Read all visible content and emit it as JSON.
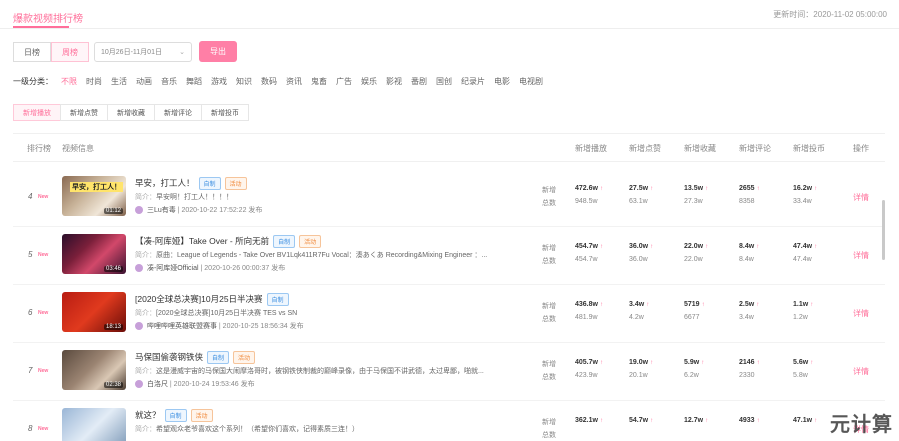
{
  "top_tab": "爆款视频排行榜",
  "update_time": "更新时间：2020-11-02 05:00:00",
  "period": {
    "day": "日榜",
    "week": "周榜"
  },
  "date_range": "10月26日-11月01日",
  "export_label": "导出",
  "category": {
    "label": "一级分类：",
    "items": [
      "不限",
      "时尚",
      "生活",
      "动画",
      "音乐",
      "舞蹈",
      "游戏",
      "知识",
      "数码",
      "资讯",
      "鬼畜",
      "广告",
      "娱乐",
      "影视",
      "番剧",
      "国创",
      "纪录片",
      "电影",
      "电视剧"
    ]
  },
  "metric_tabs": [
    "新增播放",
    "新增点赞",
    "新增收藏",
    "新增评论",
    "新增投币"
  ],
  "table_headers": {
    "rank": "排行榜",
    "info": "视频信息",
    "play": "新增播放",
    "like": "新增点赞",
    "fav": "新增收藏",
    "comment": "新增评论",
    "coin": "新增投币",
    "op": "操作"
  },
  "labels": {
    "inc": "新增",
    "tot": "总数",
    "detail": "详情",
    "desc_prefix": "简介：",
    "published": "发布",
    "new": "New"
  },
  "rows": [
    {
      "rank": "4",
      "title": "早安，打工人！",
      "badges": [
        "自制",
        "活动"
      ],
      "desc": "早安啊！打工人！！！！",
      "up": "三Lu有毒",
      "date": "2020-10-22 17:52:22",
      "duration": "01:12",
      "thumb_caption": "早安，打工人！",
      "play": [
        "472.6w",
        "948.5w"
      ],
      "like": [
        "27.5w",
        "63.1w"
      ],
      "fav": [
        "13.5w",
        "27.3w"
      ],
      "comment": [
        "2655",
        "8358"
      ],
      "coin": [
        "16.2w",
        "33.4w"
      ]
    },
    {
      "rank": "5",
      "title": "【凑-阿库娅】Take Over - 所向无前",
      "badges": [
        "自制",
        "活动"
      ],
      "desc": "原曲：League of Legends - Take Over BV1Lqk411R7Fu Vocal：湊あくあ Recording&Mixing Engineer ：...",
      "up": "凑-阿库娅Official",
      "date": "2020-10-26 00:00:37",
      "duration": "03:46",
      "thumb_caption": "",
      "play": [
        "454.7w",
        "454.7w"
      ],
      "like": [
        "36.0w",
        "36.0w"
      ],
      "fav": [
        "22.0w",
        "22.0w"
      ],
      "comment": [
        "8.4w",
        "8.4w"
      ],
      "coin": [
        "47.4w",
        "47.4w"
      ]
    },
    {
      "rank": "6",
      "title": "[2020全球总决赛]10月25日半决赛",
      "badges": [
        "自制"
      ],
      "desc": "[2020全球总决赛]10月25日半决赛 TES vs SN",
      "up": "哔哩哔哩英雄联盟赛事",
      "date": "2020-10-25 18:56:34",
      "duration": "18:13",
      "thumb_caption": "",
      "play": [
        "436.8w",
        "481.9w"
      ],
      "like": [
        "3.4w",
        "4.2w"
      ],
      "fav": [
        "5719",
        "6677"
      ],
      "comment": [
        "2.5w",
        "3.4w"
      ],
      "coin": [
        "1.1w",
        "1.2w"
      ]
    },
    {
      "rank": "7",
      "title": "马保国偷袭钢铁侠",
      "badges": [
        "自制",
        "活动"
      ],
      "desc": "这是漫威宇宙的马保国大闹摩洛哥时，被钢铁侠制裁的巅峰录像，由于马保国不讲武德，太过卑鄙，啪就...",
      "up": "白洛尺",
      "date": "2020-10-24 19:53:46",
      "duration": "02:38",
      "thumb_caption": "",
      "play": [
        "405.7w",
        "423.9w"
      ],
      "like": [
        "19.0w",
        "20.1w"
      ],
      "fav": [
        "5.9w",
        "6.2w"
      ],
      "comment": [
        "2146",
        "2330"
      ],
      "coin": [
        "5.6w",
        "5.8w"
      ]
    },
    {
      "rank": "8",
      "title": "就这？",
      "badges": [
        "自制",
        "活动"
      ],
      "desc": "希望观众老爷喜欢这个系列！（希望你们喜欢，记得素质三连！）",
      "up": "",
      "date": "",
      "duration": "",
      "thumb_caption": "",
      "play": [
        "362.1w",
        ""
      ],
      "like": [
        "54.7w",
        ""
      ],
      "fav": [
        "12.7w",
        ""
      ],
      "comment": [
        "4933",
        ""
      ],
      "coin": [
        "47.1w",
        ""
      ]
    }
  ],
  "watermark": "元计算",
  "colors": {
    "accent": "#ff6f9a",
    "self_badge": "#3a8de0",
    "event_badge": "#f08a3c"
  }
}
